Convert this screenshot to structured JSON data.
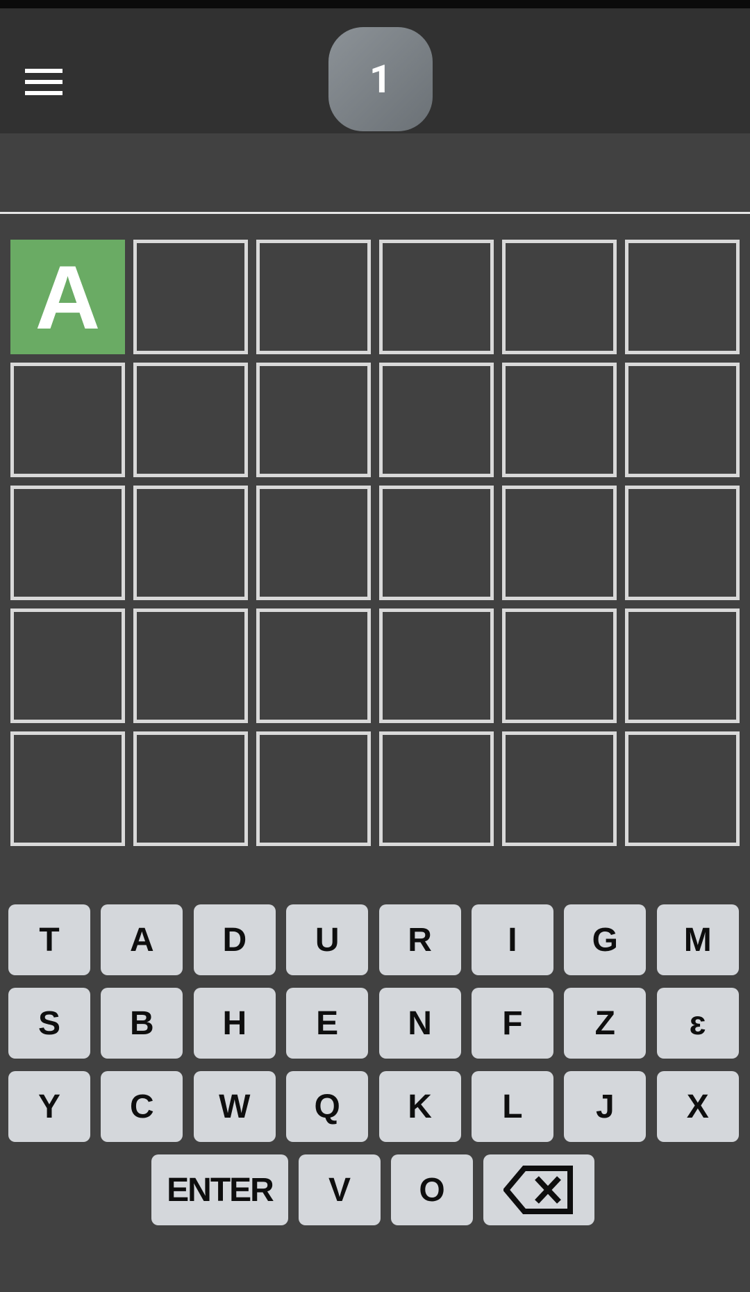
{
  "header": {
    "menu_icon": "hamburger-menu-icon",
    "level": "1"
  },
  "board": {
    "rows": [
      [
        "A",
        "",
        "",
        "",
        "",
        ""
      ],
      [
        "",
        "",
        "",
        "",
        "",
        ""
      ],
      [
        "",
        "",
        "",
        "",
        "",
        ""
      ],
      [
        "",
        "",
        "",
        "",
        "",
        ""
      ],
      [
        "",
        "",
        "",
        "",
        "",
        ""
      ]
    ],
    "states": [
      [
        "correct",
        "empty",
        "empty",
        "empty",
        "empty",
        "empty"
      ]
    ],
    "colors": {
      "correct": "#6aab64",
      "tile_border": "#d9d9d9",
      "background": "#414141"
    }
  },
  "keyboard": {
    "row1": [
      "T",
      "A",
      "D",
      "U",
      "R",
      "I",
      "G",
      "M"
    ],
    "row2": [
      "S",
      "B",
      "H",
      "E",
      "N",
      "F",
      "Z",
      "ɛ"
    ],
    "row3": [
      "Y",
      "C",
      "W",
      "Q",
      "K",
      "L",
      "J",
      "X"
    ],
    "row4": [
      "ENTER",
      "V",
      "O"
    ],
    "backspace_icon": "backspace-icon"
  }
}
